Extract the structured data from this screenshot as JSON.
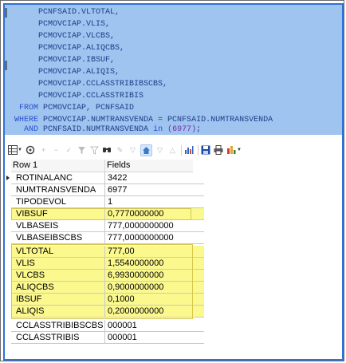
{
  "sql": {
    "lines": [
      "      PCNFSAID.VLTOTAL,",
      "      PCMOVCIAP.VLIS,",
      "      PCMOVCIAP.VLCBS,",
      "      PCMOVCIAP.ALIQCBS,",
      "      PCMOVCIAP.IBSUF,",
      "      PCMOVCIAP.ALIQIS,",
      "      PCMOVCIAP.CCLASSTRIBIBSCBS,",
      "      PCMOVCIAP.CCLASSTRIBIS"
    ],
    "from_kw": "FROM",
    "from_rest": " PCMOVCIAP, PCNFSAID",
    "where_kw": "WHERE",
    "where_rest": " PCMOVCIAP.NUMTRANSVENDA = PCNFSAID.NUMTRANSVENDA",
    "and_kw": "AND",
    "and_rest": " PCNFSAID.NUMTRANSVENDA ",
    "in_kw": "in",
    "in_val": " (6977)",
    "end": ";"
  },
  "toolbar": {
    "icons": [
      "grid-icon",
      "dropdown-caret-icon",
      "record-icon",
      "add-icon",
      "remove-icon",
      "confirm-icon",
      "filter-icon",
      "filter-edit-icon",
      "find-icon",
      "edit-icon",
      "filter-list-icon",
      "home-icon",
      "down-icon",
      "up-icon",
      "chart-icon",
      "save-icon",
      "print-icon",
      "bar-chart-icon",
      "dropdown-caret-icon"
    ]
  },
  "grid": {
    "col1_header": "Row 1",
    "col2_header": "Fields",
    "rows": [
      {
        "field": "ROTINALANC",
        "value": "3422",
        "highlight": false
      },
      {
        "field": "NUMTRANSVENDA",
        "value": "6977",
        "highlight": false
      },
      {
        "field": "TIPODEVOL",
        "value": "1",
        "highlight": false
      },
      {
        "field": "VIBSUF",
        "value": "0,7770000000",
        "highlight": true
      },
      {
        "field": "VLBASEIS",
        "value": "777,0000000000",
        "highlight": false
      },
      {
        "field": "VLBASEIBSCBS",
        "value": "777,0000000000",
        "highlight": false
      },
      {
        "field": "VLTOTAL",
        "value": "777,00",
        "highlight": true
      },
      {
        "field": "VLIS",
        "value": "1,5540000000",
        "highlight": true
      },
      {
        "field": "VLCBS",
        "value": "6,9930000000",
        "highlight": true
      },
      {
        "field": "ALIQCBS",
        "value": "0,9000000000",
        "highlight": true
      },
      {
        "field": "IBSUF",
        "value": "0,1000",
        "highlight": true
      },
      {
        "field": "ALIQIS",
        "value": "0,2000000000",
        "highlight": true
      },
      {
        "field": "CCLASSTRIBIBSCBS",
        "value": "000001",
        "highlight": false
      },
      {
        "field": "CCLASSTRIBIS",
        "value": "000001",
        "highlight": false
      }
    ]
  },
  "colors": {
    "editor_bg": "#9ec4ef",
    "highlight": "#fbf98d",
    "frame": "#2f72d6"
  }
}
